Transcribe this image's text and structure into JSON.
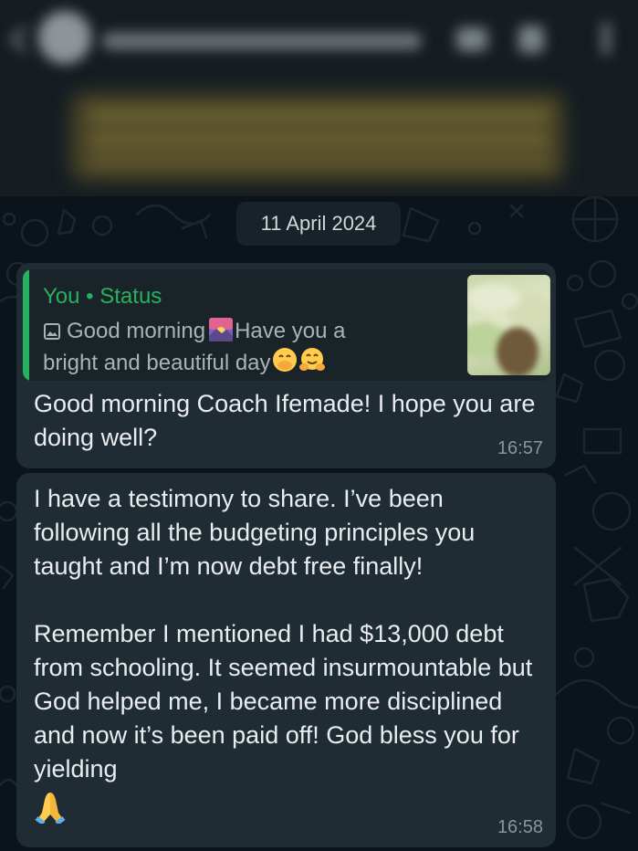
{
  "chat": {
    "date_chip": "11 April 2024"
  },
  "messages": [
    {
      "reply": {
        "author": "You",
        "source": "Status",
        "separator": "•",
        "text_a": "Good morning",
        "text_b": "Have you a bright and beautiful day"
      },
      "text": "Good morning Coach Ifemade! I hope you are doing well?",
      "time": "16:57"
    },
    {
      "text": "I have a testimony to share. I’ve been following all the budgeting principles you taught and I’m now debt free finally!\n\nRemember I mentioned I had $13,000 debt from schooling. It seemed insurmountable but God helped me, I became more disciplined and now it’s been paid off! God bless you for yielding",
      "time": "16:58"
    }
  ],
  "colors": {
    "background": "#0b141a",
    "bubble": "#202c33",
    "quote_accent": "#25b15f",
    "timestamp": "#8696a0"
  },
  "icons": [
    "image-icon",
    "sunrise-emoji",
    "face-hand-over-mouth-emoji",
    "hugging-face-emoji",
    "folded-hands-emoji"
  ]
}
